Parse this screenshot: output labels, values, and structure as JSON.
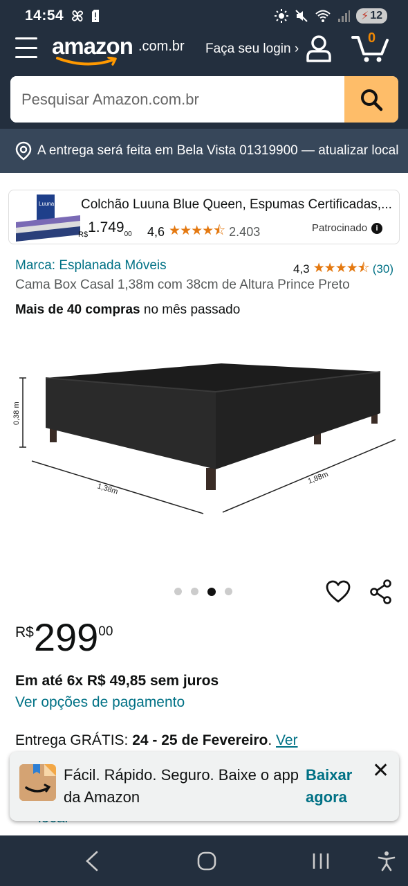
{
  "status_bar": {
    "time": "14:54",
    "battery": "12",
    "icons": [
      "pinwheel-icon",
      "sim-alert-icon",
      "brightness-icon",
      "mute-icon",
      "wifi-icon",
      "signal-icon",
      "battery-icon"
    ]
  },
  "header": {
    "logo_word": "amazon",
    "logo_domain": ".com.br",
    "login_label": "Faça seu login ›",
    "cart_count": "0"
  },
  "search": {
    "placeholder": "Pesquisar Amazon.com.br"
  },
  "delivery_bar": {
    "text": "A entrega será feita em Bela Vista 01319900 — atualizar local"
  },
  "sponsored": {
    "title": "Colchão Luuna Blue Queen, Espumas Certificadas,...",
    "price_currency": "R$",
    "price_whole": "1.749",
    "price_cents": "00",
    "rating": "4,6",
    "stars": "★★★★⯪",
    "review_count": "2.403",
    "label": "Patrocinado",
    "thumb_text": "Luuna"
  },
  "product": {
    "brand": "Marca: Esplanada Móveis",
    "rating": "4,3",
    "stars": "★★★★⯪",
    "review_count": "(30)",
    "title": "Cama Box Casal 1,38m com 38cm de Altura Prince Preto",
    "bought_bold": "Mais de 40 compras",
    "bought_rest": " no mês passado",
    "image_dims": {
      "height": "0,38 m",
      "width": "1,38m",
      "length": "1,88m"
    },
    "carousel": {
      "count": 4,
      "active": 3
    },
    "price_currency": "R$",
    "price_whole": "299",
    "price_cents": "00",
    "installments": "Em até 6x R$ 49,85 sem juros",
    "payment_link": "Ver opções de pagamento",
    "delivery_prefix": "Entrega GRÁTIS: ",
    "delivery_dates": "24 - 25 de Fevereiro",
    "delivery_dot": ". ",
    "delivery_link": "Ver",
    "behind_text": "local"
  },
  "toast": {
    "message": "Fácil. Rápido. Seguro. Baixe o app da Amazon",
    "cta": "Baixar agora"
  },
  "colors": {
    "header_bg": "#232f3e",
    "delivery_bg": "#37475a",
    "search_button": "#febd69",
    "link": "#007185",
    "star": "#e47911",
    "cart_count": "#f08804"
  }
}
